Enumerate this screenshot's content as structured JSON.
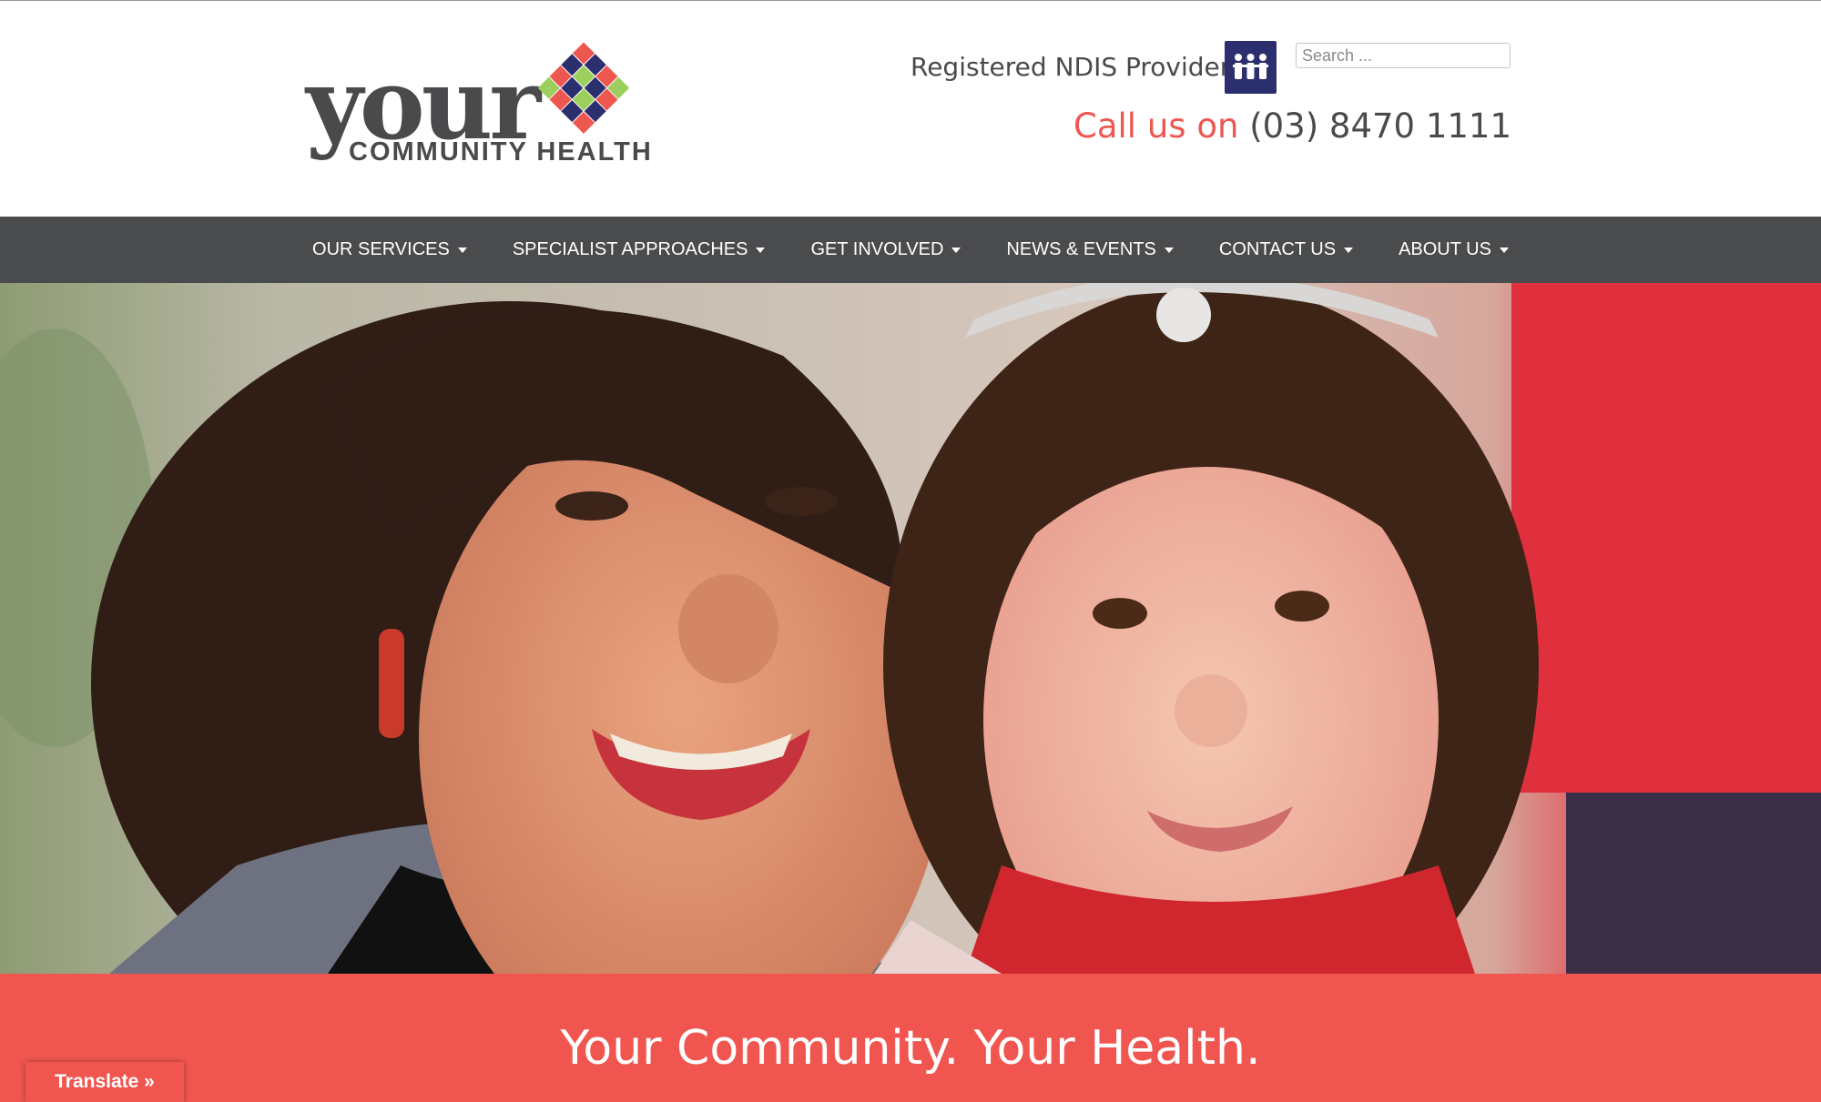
{
  "brand": {
    "logo_word": "your",
    "logo_subtitle": "COMMUNITY HEALTH",
    "colors": {
      "accent": "#f0564f",
      "dark": "#4a4a4c",
      "navy": "#2c2f6d",
      "nav_bg": "#4a4b4d"
    }
  },
  "header": {
    "ndis_label": "Registered NDIS Provider",
    "ndis_icon": "ndis-people-icon",
    "search_placeholder": "Search ...",
    "call_prefix": "Call us on",
    "call_number": "(03) 8470 1111"
  },
  "nav": {
    "items": [
      {
        "label": "OUR SERVICES"
      },
      {
        "label": "SPECIALIST APPROACHES"
      },
      {
        "label": "GET INVOLVED"
      },
      {
        "label": "NEWS & EVENTS"
      },
      {
        "label": "CONTACT US"
      },
      {
        "label": "ABOUT US"
      }
    ]
  },
  "banner": {
    "text": "Your Community. Your Health."
  },
  "translate": {
    "label": "Translate »"
  }
}
